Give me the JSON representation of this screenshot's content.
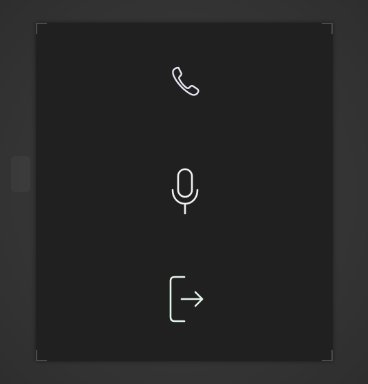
{
  "panel": {
    "buttons": [
      {
        "id": "call",
        "icon": "phone-icon",
        "color": "#e6e6f5"
      },
      {
        "id": "mic",
        "icon": "microphone-icon",
        "color": "#f2f2f2"
      },
      {
        "id": "exit",
        "icon": "exit-icon",
        "color": "#e3f5e8"
      }
    ]
  },
  "colors": {
    "background": "#363636",
    "panel": "#202020"
  }
}
